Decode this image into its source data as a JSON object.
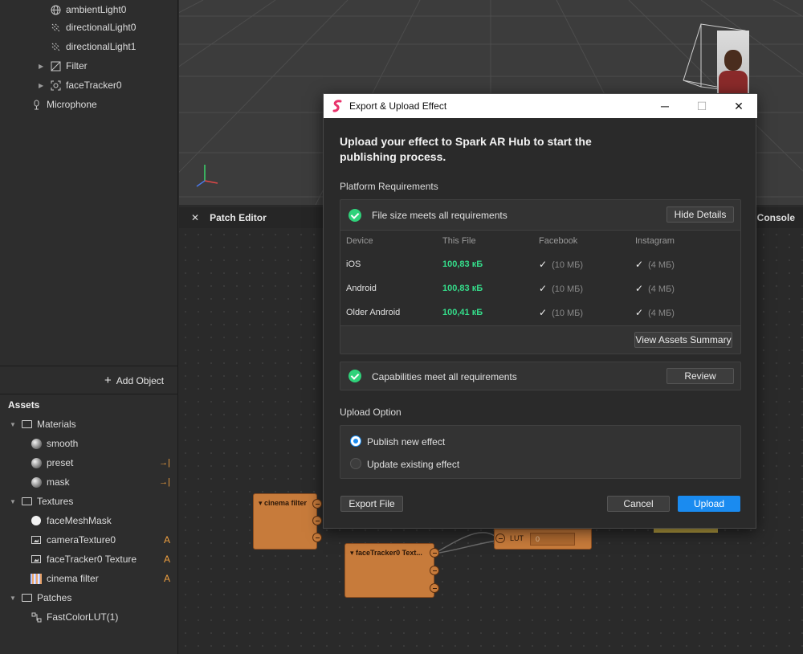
{
  "scene_tree": [
    {
      "label": "ambientLight0",
      "icon": "globe-icon"
    },
    {
      "label": "directionalLight0",
      "icon": "directional-light-icon"
    },
    {
      "label": "directionalLight1",
      "icon": "directional-light-icon"
    },
    {
      "label": "Filter",
      "icon": "filter-icon"
    },
    {
      "label": "faceTracker0",
      "icon": "face-tracker-icon"
    },
    {
      "label": "Microphone",
      "icon": "microphone-icon"
    }
  ],
  "add_object_label": "Add Object",
  "assets": {
    "title": "Assets",
    "materials_label": "Materials",
    "materials": [
      "smooth",
      "preset",
      "mask"
    ],
    "textures_label": "Textures",
    "textures": [
      "faceMeshMask",
      "cameraTexture0",
      "faceTracker0 Texture",
      "cinema filter"
    ],
    "texture_badge": "A",
    "patches_label": "Patches",
    "patches": [
      "FastColorLUT(1)"
    ]
  },
  "patch_editor": {
    "title": "Patch Editor",
    "console_label": "Console",
    "nodes": {
      "cinema_filter": "cinema filter",
      "face_tracker_texture": "faceTracker0 Text...",
      "lut_label": "LUT",
      "lut_value": "0"
    }
  },
  "dialog": {
    "title": "Export & Upload Effect",
    "heading": "Upload your effect to Spark AR Hub to start the publishing process.",
    "platform_requirements_label": "Platform Requirements",
    "file_size_status": "File size meets all requirements",
    "hide_details_label": "Hide Details",
    "table": {
      "headers": [
        "Device",
        "This File",
        "Facebook",
        "Instagram"
      ],
      "rows": [
        {
          "device": "iOS",
          "size": "100,83 кБ",
          "facebook_check": "✓",
          "facebook_limit": "(10 МБ)",
          "instagram_check": "✓",
          "instagram_limit": "(4 МБ)"
        },
        {
          "device": "Android",
          "size": "100,83 кБ",
          "facebook_check": "✓",
          "facebook_limit": "(10 МБ)",
          "instagram_check": "✓",
          "instagram_limit": "(4 МБ)"
        },
        {
          "device": "Older Android",
          "size": "100,41 кБ",
          "facebook_check": "✓",
          "facebook_limit": "(10 МБ)",
          "instagram_check": "✓",
          "instagram_limit": "(4 МБ)"
        }
      ]
    },
    "view_assets_summary_label": "View Assets Summary",
    "capabilities_status": "Capabilities meet all requirements",
    "review_label": "Review",
    "upload_option_label": "Upload Option",
    "options": [
      {
        "label": "Publish new effect",
        "selected": true
      },
      {
        "label": "Update existing effect",
        "selected": false
      }
    ],
    "export_file_label": "Export File",
    "cancel_label": "Cancel",
    "upload_label": "Upload",
    "accent_color": "#1a8bf0",
    "success_color": "#2fd27a"
  }
}
